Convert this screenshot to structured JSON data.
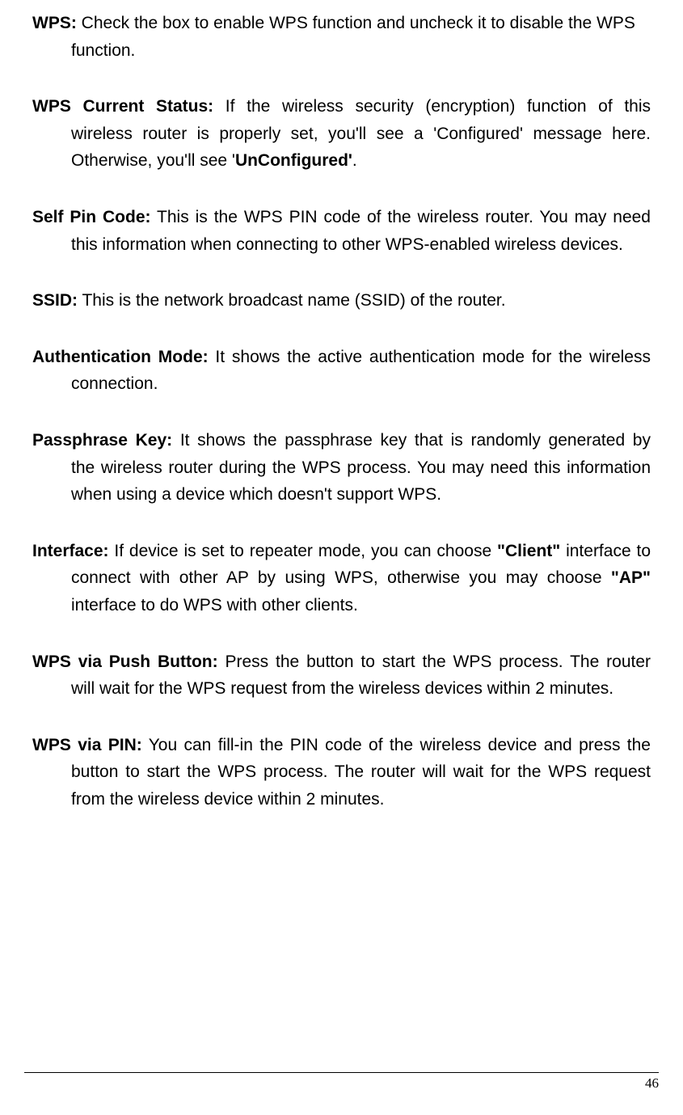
{
  "items": [
    {
      "term": "WPS:",
      "text": " Check the box to enable WPS function and uncheck it to disable the WPS function.",
      "justify": true
    },
    {
      "term": "WPS Current Status:",
      "richParts": [
        " If the wireless security (encryption) function of this wireless router is properly set, you'll see a 'Configured' message here. Otherwise, you'll see '"
      ],
      "boldEnd": "UnConfigured'",
      "afterBold": ".",
      "justify": true,
      "wordSpaceTerm": "3px",
      "splitLines": true,
      "line1Plain": " If the wireless security (encryption) function of this",
      "line2Plain": "wireless router is properly set, you'll see a 'Configured' message here.",
      "line3PlainPre": "Otherwise, you'll see '",
      "line3Bold": "UnConfigured'",
      "line3After": "."
    },
    {
      "term": "Self Pin Code:",
      "text": " This is the WPS PIN code of the wireless router. You may need this information when connecting to other WPS-enabled wireless devices.",
      "justify": true
    },
    {
      "term": "SSID:",
      "text": " This is the network broadcast name (SSID) of the router.",
      "justify": false
    },
    {
      "term": "Authentication Mode:",
      "text": " It shows the active authentication mode for the wireless connection.",
      "justify": true
    },
    {
      "term": "Passphrase Key:",
      "text": " It shows the passphrase key that is randomly generated by the wireless router during the WPS process. You may need this information when using a device which doesn't support WPS.",
      "justify": true
    },
    {
      "term": "Interface:",
      "splitInterface": true,
      "pre1": " If device is set to repeater mode, you can choose ",
      "bold1": "\"Client\"",
      "post1": " interface to",
      "line2pre": "connect with other AP by using WPS, otherwise you may choose ",
      "bold2": "\"AP\"",
      "line3": "interface to do WPS with other clients."
    },
    {
      "term": "WPS via Push Button:",
      "text": " Press the button to start the WPS process. The router will wait for the WPS request from the wireless devices within 2 minutes.",
      "justify": true
    },
    {
      "term": "WPS via PIN:",
      "text": " You can fill-in the PIN code of the wireless device and press the button to start the WPS process. The router will wait for the WPS request from the wireless device within 2 minutes.",
      "justify": true
    }
  ],
  "pageNumber": "46"
}
